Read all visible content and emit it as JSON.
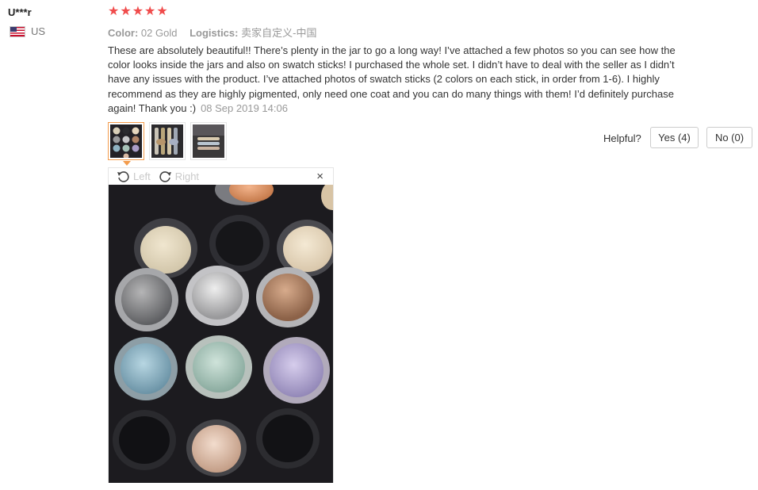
{
  "review": {
    "user": "U***r",
    "country": "US",
    "rating": 5,
    "color_label": "Color:",
    "color_value": "02 Gold",
    "logistics_label": "Logistics:",
    "logistics_value": "卖家自定义-中国",
    "text": "These are absolutely beautiful!! There’s plenty in the jar to go a long way! I’ve attached a few photos so you can see how the color looks inside the jars and also on swatch sticks! I purchased the whole set. I didn’t have to deal with the seller as I didn’t have any issues with the product. I’ve attached photos of swatch sticks (2 colors on each stick, in order from 1-6). I highly recommend as they are highly pigmented, only need one coat and you can do many things with them! I’d definitely purchase again! Thank you :)",
    "date": "08 Sep 2019 14:06"
  },
  "helpful": {
    "label": "Helpful?",
    "yes_label": "Yes (4)",
    "no_label": "No (0)"
  },
  "viewer": {
    "rotate_left": "Left",
    "rotate_right": "Right",
    "close_symbol": "×"
  },
  "icons": {
    "star": "star-icon",
    "flag": "us-flag-icon",
    "rotate_left": "rotate-left-icon",
    "rotate_right": "rotate-right-icon",
    "close": "close-icon"
  },
  "colors": {
    "star": "#f04b4b",
    "active_thumb_border": "#f39c4d",
    "muted_text": "#999999"
  }
}
